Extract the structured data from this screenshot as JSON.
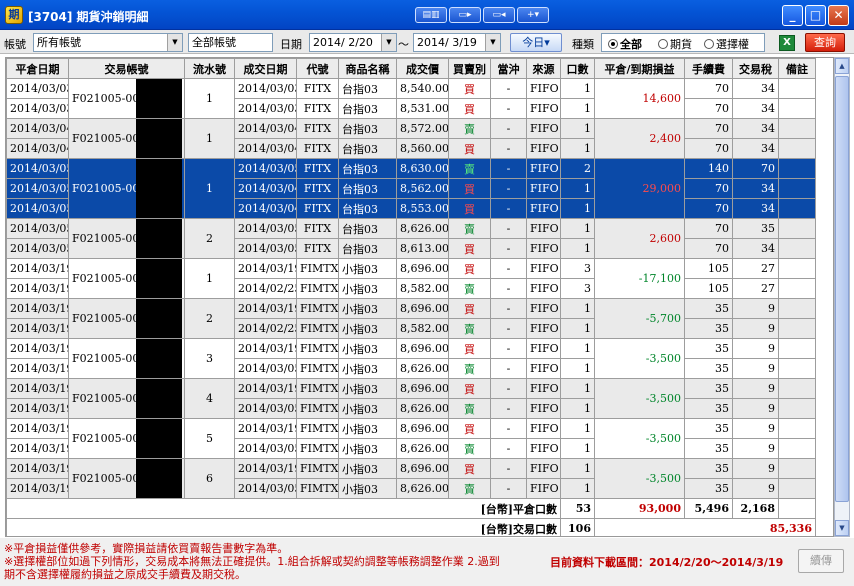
{
  "window": {
    "title": "[3704] 期貨沖銷明細",
    "app_icon": "期",
    "toolbar_icons": [
      "layout-icon",
      "window-icon",
      "restore-window-icon",
      "plus-icon"
    ],
    "controls": {
      "minimize": "_",
      "maximize": "□",
      "close": "✕"
    }
  },
  "filters": {
    "account_label": "帳號",
    "account_value": "所有帳號",
    "sub_account_value": "全部帳號",
    "date_label": "日期",
    "date_from": "2014/ 2/20",
    "date_sep": "～",
    "date_to": "2014/ 3/19",
    "today_button": "今日▾",
    "type_label": "種類",
    "radio_all": "全部",
    "radio_futures": "期貨",
    "radio_options": "選擇權",
    "query_button": "查詢"
  },
  "table": {
    "headers": [
      "平倉日期",
      "交易帳號",
      "流水號",
      "成交日期",
      "代號",
      "商品名稱",
      "成交價",
      "買賣別",
      "當沖",
      "來源",
      "口數",
      "平倉/到期損益",
      "手續費",
      "交易稅",
      "備註"
    ],
    "groups": [
      {
        "account": "F021005-005",
        "seq": "1",
        "pl": "14,600",
        "shade": false,
        "sel": false,
        "rows": [
          {
            "close_date": "2014/03/03",
            "trade_date": "2014/03/03",
            "code": "FITX",
            "name": "台指03",
            "price": "8,540.00",
            "side": "買",
            "day": "-",
            "src": "FIFO",
            "qty": "1",
            "fee": "70",
            "tax": "34"
          },
          {
            "close_date": "2014/03/03",
            "trade_date": "2014/03/03",
            "code": "FITX",
            "name": "台指03",
            "price": "8,531.00",
            "side": "買",
            "day": "-",
            "src": "FIFO",
            "qty": "1",
            "fee": "70",
            "tax": "34"
          }
        ]
      },
      {
        "account": "F021005-005",
        "seq": "1",
        "pl": "2,400",
        "shade": true,
        "sel": false,
        "rows": [
          {
            "close_date": "2014/03/04",
            "trade_date": "2014/03/04",
            "code": "FITX",
            "name": "台指03",
            "price": "8,572.00",
            "side": "賣",
            "day": "-",
            "src": "FIFO",
            "qty": "1",
            "fee": "70",
            "tax": "34"
          },
          {
            "close_date": "2014/03/04",
            "trade_date": "2014/03/04",
            "code": "FITX",
            "name": "台指03",
            "price": "8,560.00",
            "side": "買",
            "day": "-",
            "src": "FIFO",
            "qty": "1",
            "fee": "70",
            "tax": "34"
          }
        ]
      },
      {
        "account": "F021005-005",
        "seq": "1",
        "pl": "29,000",
        "shade": false,
        "sel": true,
        "rows": [
          {
            "close_date": "2014/03/05",
            "trade_date": "2014/03/05",
            "code": "FITX",
            "name": "台指03",
            "price": "8,630.00",
            "side": "賣",
            "day": "-",
            "src": "FIFO",
            "qty": "2",
            "fee": "140",
            "tax": "70"
          },
          {
            "close_date": "2014/03/05",
            "trade_date": "2014/03/04",
            "code": "FITX",
            "name": "台指03",
            "price": "8,562.00",
            "side": "買",
            "day": "-",
            "src": "FIFO",
            "qty": "1",
            "fee": "70",
            "tax": "34"
          },
          {
            "close_date": "2014/03/05",
            "trade_date": "2014/03/04",
            "code": "FITX",
            "name": "台指03",
            "price": "8,553.00",
            "side": "買",
            "day": "-",
            "src": "FIFO",
            "qty": "1",
            "fee": "70",
            "tax": "34"
          }
        ]
      },
      {
        "account": "F021005-005",
        "seq": "2",
        "pl": "2,600",
        "shade": true,
        "sel": false,
        "rows": [
          {
            "close_date": "2014/03/05",
            "trade_date": "2014/03/05",
            "code": "FITX",
            "name": "台指03",
            "price": "8,626.00",
            "side": "賣",
            "day": "-",
            "src": "FIFO",
            "qty": "1",
            "fee": "70",
            "tax": "35"
          },
          {
            "close_date": "2014/03/05",
            "trade_date": "2014/03/05",
            "code": "FITX",
            "name": "台指03",
            "price": "8,613.00",
            "side": "買",
            "day": "-",
            "src": "FIFO",
            "qty": "1",
            "fee": "70",
            "tax": "34"
          }
        ]
      },
      {
        "account": "F021005-005",
        "seq": "1",
        "pl": "-17,100",
        "shade": false,
        "sel": false,
        "rows": [
          {
            "close_date": "2014/03/19",
            "trade_date": "2014/03/19",
            "code": "FIMTX",
            "name": "小指03",
            "price": "8,696.00",
            "side": "買",
            "day": "-",
            "src": "FIFO",
            "qty": "3",
            "fee": "105",
            "tax": "27"
          },
          {
            "close_date": "2014/03/19",
            "trade_date": "2014/02/25",
            "code": "FIMTX",
            "name": "小指03",
            "price": "8,582.00",
            "side": "賣",
            "day": "-",
            "src": "FIFO",
            "qty": "3",
            "fee": "105",
            "tax": "27"
          }
        ]
      },
      {
        "account": "F021005-005",
        "seq": "2",
        "pl": "-5,700",
        "shade": true,
        "sel": false,
        "rows": [
          {
            "close_date": "2014/03/19",
            "trade_date": "2014/03/19",
            "code": "FIMTX",
            "name": "小指03",
            "price": "8,696.00",
            "side": "買",
            "day": "-",
            "src": "FIFO",
            "qty": "1",
            "fee": "35",
            "tax": "9"
          },
          {
            "close_date": "2014/03/19",
            "trade_date": "2014/02/25",
            "code": "FIMTX",
            "name": "小指03",
            "price": "8,582.00",
            "side": "賣",
            "day": "-",
            "src": "FIFO",
            "qty": "1",
            "fee": "35",
            "tax": "9"
          }
        ]
      },
      {
        "account": "F021005-005",
        "seq": "3",
        "pl": "-3,500",
        "shade": false,
        "sel": false,
        "rows": [
          {
            "close_date": "2014/03/19",
            "trade_date": "2014/03/19",
            "code": "FIMTX",
            "name": "小指03",
            "price": "8,696.00",
            "side": "買",
            "day": "-",
            "src": "FIFO",
            "qty": "1",
            "fee": "35",
            "tax": "9"
          },
          {
            "close_date": "2014/03/19",
            "trade_date": "2014/03/05",
            "code": "FIMTX",
            "name": "小指03",
            "price": "8,626.00",
            "side": "賣",
            "day": "-",
            "src": "FIFO",
            "qty": "1",
            "fee": "35",
            "tax": "9"
          }
        ]
      },
      {
        "account": "F021005-005",
        "seq": "4",
        "pl": "-3,500",
        "shade": true,
        "sel": false,
        "rows": [
          {
            "close_date": "2014/03/19",
            "trade_date": "2014/03/19",
            "code": "FIMTX",
            "name": "小指03",
            "price": "8,696.00",
            "side": "買",
            "day": "-",
            "src": "FIFO",
            "qty": "1",
            "fee": "35",
            "tax": "9"
          },
          {
            "close_date": "2014/03/19",
            "trade_date": "2014/03/05",
            "code": "FIMTX",
            "name": "小指03",
            "price": "8,626.00",
            "side": "賣",
            "day": "-",
            "src": "FIFO",
            "qty": "1",
            "fee": "35",
            "tax": "9"
          }
        ]
      },
      {
        "account": "F021005-005",
        "seq": "5",
        "pl": "-3,500",
        "shade": false,
        "sel": false,
        "rows": [
          {
            "close_date": "2014/03/19",
            "trade_date": "2014/03/19",
            "code": "FIMTX",
            "name": "小指03",
            "price": "8,696.00",
            "side": "買",
            "day": "-",
            "src": "FIFO",
            "qty": "1",
            "fee": "35",
            "tax": "9"
          },
          {
            "close_date": "2014/03/19",
            "trade_date": "2014/03/05",
            "code": "FIMTX",
            "name": "小指03",
            "price": "8,626.00",
            "side": "賣",
            "day": "-",
            "src": "FIFO",
            "qty": "1",
            "fee": "35",
            "tax": "9"
          }
        ]
      },
      {
        "account": "F021005-005",
        "seq": "6",
        "pl": "-3,500",
        "shade": true,
        "sel": false,
        "rows": [
          {
            "close_date": "2014/03/19",
            "trade_date": "2014/03/19",
            "code": "FIMTX",
            "name": "小指03",
            "price": "8,696.00",
            "side": "買",
            "day": "-",
            "src": "FIFO",
            "qty": "1",
            "fee": "35",
            "tax": "9"
          },
          {
            "close_date": "2014/03/19",
            "trade_date": "2014/03/05",
            "code": "FIMTX",
            "name": "小指03",
            "price": "8,626.00",
            "side": "賣",
            "day": "-",
            "src": "FIFO",
            "qty": "1",
            "fee": "35",
            "tax": "9"
          }
        ]
      }
    ],
    "summary": {
      "close_label": "[台幣]平倉口數",
      "close_qty": "53",
      "close_pl": "93,000",
      "close_fee": "5,496",
      "close_tax": "2,168",
      "trade_label": "[台幣]交易口數",
      "trade_qty": "106",
      "net_pl": "85,336"
    }
  },
  "footer": {
    "note1": "※平倉損益僅供參考，實際損益請依買賣報告書數字為準。",
    "note2": "※選擇權部位如過下列情形，交易成本將無法正確提供。1.組合拆解或契約調整等帳務調整作業 2.過到",
    "note3": "期不含選擇權履約損益之原成交手續費及期交稅。",
    "range_text": "目前資料下載區間：2014/2/20～2014/3/19",
    "next_button": "續傳"
  }
}
